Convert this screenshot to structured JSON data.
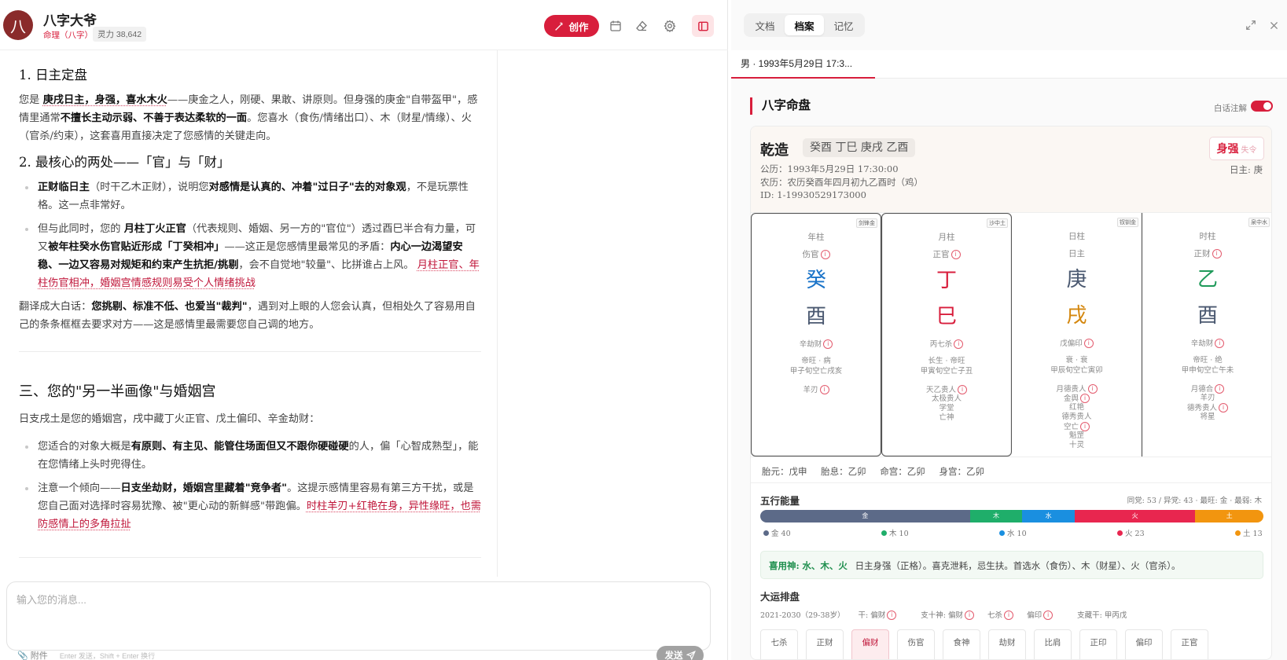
{
  "header": {
    "avatar_char": "八",
    "agent_name": "八字大爷",
    "category": "命理（八字）",
    "power": "灵力 38,642",
    "create_label": "创作"
  },
  "chat": {
    "s1_title": "1. 日主定盘",
    "s1_p_a": "您是 ",
    "s1_p_b": "庚戌日主，身强，喜水木火",
    "s1_p_c": "——庚金之人，刚硬、果敢、讲原则。但身强的庚金\"自带盔甲\"，感情里通常",
    "s1_p_d": "不擅长主动示弱、不善于表达柔软的一面",
    "s1_p_e": "。您喜水（食伤/情绪出口）、木（财星/情缘）、火（官杀/约束），这套喜用直接决定了您感情的关键走向。",
    "s2_title": "2. 最核心的两处——「官」与「财」",
    "b1_a": "正财临日主",
    "b1_b": "（时干乙木正财），说明您",
    "b1_c": "对感情是认真的、冲着\"过日子\"去的对象观",
    "b1_d": "，不是玩票性格。这一点非常好。",
    "b2_a": "但与此同时，您的 ",
    "b2_b": "月柱丁火正官",
    "b2_c": "（代表规则、婚姻、另一方的\"官位\"）透过酉巳半合有力量，可又",
    "b2_d": "被年柱癸水伤官贴近形成「丁癸相冲」",
    "b2_e": "——这正是您感情里最常见的矛盾：",
    "b2_f": "内心一边渴望安稳、一边又容易对规矩和约束产生抗拒/挑剔",
    "b2_g": "，会不自觉地\"较量\"、比拼谁占上风。",
    "b2_h": "月柱正官、年柱伤官相冲，婚姻宫情感规则易受个人情绪挑战",
    "tr_a": "翻译成大白话：",
    "tr_b": "您挑剔、标准不低、也爱当\"裁判\"",
    "tr_c": "，遇到对上眼的人您会认真，但相处久了容易用自己的条条框框去要求对方——这是感情里最需要您自己调的地方。",
    "s3_title": "三、您的\"另一半画像\"与婚姻宫",
    "s3_p": "日支戌土是您的婚姻宫，戌中藏丁火正官、戊土偏印、辛金劫财：",
    "c1_a": "您适合的对象大概是",
    "c1_b": "有原则、有主见、能管住场面但又不跟你硬碰硬",
    "c1_c": "的人，偏「心智成熟型」，能在您情绪上头时兜得住。",
    "c2_a": "注意一个倾向——",
    "c2_b": "日支坐劫财，婚姻宫里藏着\"竞争者\"",
    "c2_c": "。这提示感情里容易有第三方干扰，或是您自己面对选择时容易犹豫、被\"更心动的新鲜感\"带跑偏。",
    "c2_d": "时柱羊刃+红艳在身，异性缘旺，也需防感情上的多角拉扯"
  },
  "input": {
    "placeholder": "输入您的消息...",
    "attach_label": "附件",
    "hint": "Enter 发送，Shift + Enter 换行",
    "send_label": "发送"
  },
  "right": {
    "tabs": [
      "文档",
      "档案",
      "记忆"
    ],
    "record_tab": "男 · 1993年5月29日 17:3...",
    "section_title": "八字命盘",
    "toggle_label": "白话注解",
    "qianzao": "乾造",
    "pillars": "癸酉 丁巳 庚戌 乙酉",
    "gongli": "公历：1993年5月29日 17:30:00",
    "nongli": "农历：农历癸酉年四月初九乙酉时（鸡）",
    "id": "ID: 1-19930529173000",
    "strength": "身强",
    "strength_note": "失令",
    "day_master": "日主: 庚"
  },
  "columns": [
    {
      "label": "年柱",
      "badge": "剑锋金",
      "role": "伤官",
      "gan": "癸",
      "gan_color": "#1a73c8",
      "zhi": "酉",
      "zhi_color": "#4a5870",
      "hidden": "辛劫财",
      "state": "帝旺 · 病",
      "kong": "甲子旬空亡戌亥",
      "stars": [
        "羊刃"
      ]
    },
    {
      "label": "月柱",
      "badge": "沙中土",
      "role": "正官",
      "gan": "丁",
      "gan_color": "#d81e3c",
      "zhi": "巳",
      "zhi_color": "#d81e3c",
      "hidden": "丙七杀",
      "state": "长生 · 帝旺",
      "kong": "甲寅旬空亡子丑",
      "stars": [
        "天乙贵人",
        "太极贵人",
        "学堂",
        "亡神"
      ]
    },
    {
      "label": "日柱",
      "badge": "钗钏金",
      "role": "日主",
      "gan": "庚",
      "gan_color": "#4a5870",
      "zhi": "戌",
      "zhi_color": "#d4870e",
      "hidden": "戊偏印",
      "state": "衰 · 衰",
      "kong": "甲辰旬空亡寅卯",
      "stars": [
        "月德贵人",
        "金舆",
        "红艳",
        "德秀贵人",
        "空亡",
        "魁罡",
        "十灵"
      ]
    },
    {
      "label": "时柱",
      "badge": "泉中水",
      "role": "正财",
      "gan": "乙",
      "gan_color": "#1f9a5a",
      "zhi": "酉",
      "zhi_color": "#4a5870",
      "hidden": "辛劫财",
      "state": "帝旺 · 绝",
      "kong": "甲申旬空亡午未",
      "stars": [
        "月德合",
        "羊刃",
        "德秀贵人",
        "将星"
      ]
    }
  ],
  "tai_row": {
    "taiyuan": "胎元：戊申",
    "taixi": "胎息：乙卯",
    "minggong": "命宫：乙卯",
    "shengong": "身宫：乙卯"
  },
  "wuxing": {
    "title": "五行能量",
    "stats": "同党: 53 / 异党: 43 · 最旺: 金 · 最弱: 木",
    "segments": [
      {
        "name": "金",
        "value": 40,
        "color": "#5c6a88"
      },
      {
        "name": "木",
        "value": 10,
        "color": "#1fae6a"
      },
      {
        "name": "水",
        "value": 10,
        "color": "#1a8fe0"
      },
      {
        "name": "火",
        "value": 23,
        "color": "#e8264f"
      },
      {
        "name": "土",
        "value": 13,
        "color": "#f2950f"
      }
    ],
    "legend": [
      "金 40",
      "木 10",
      "水 10",
      "火 23",
      "土 13"
    ]
  },
  "yongshen": {
    "label": "喜用神:",
    "value": "水、木、火",
    "desc": "日主身强（正格）。喜克泄耗，忌生扶。首选水（食伤）、木（财星）、火（官杀）。"
  },
  "dayun": {
    "title": "大运排盘",
    "period": "2021-2030（29-38岁）",
    "gan_info": "干: 偏财",
    "zhi_info": "支十神: 偏财",
    "qisha": "七杀",
    "pianyin": "偏印",
    "canggan": "支藏干: 甲丙戊",
    "cards": [
      "七杀",
      "正财",
      "偏财",
      "伤官",
      "食神",
      "劫财",
      "比肩",
      "正印",
      "偏印",
      "正官"
    ]
  }
}
